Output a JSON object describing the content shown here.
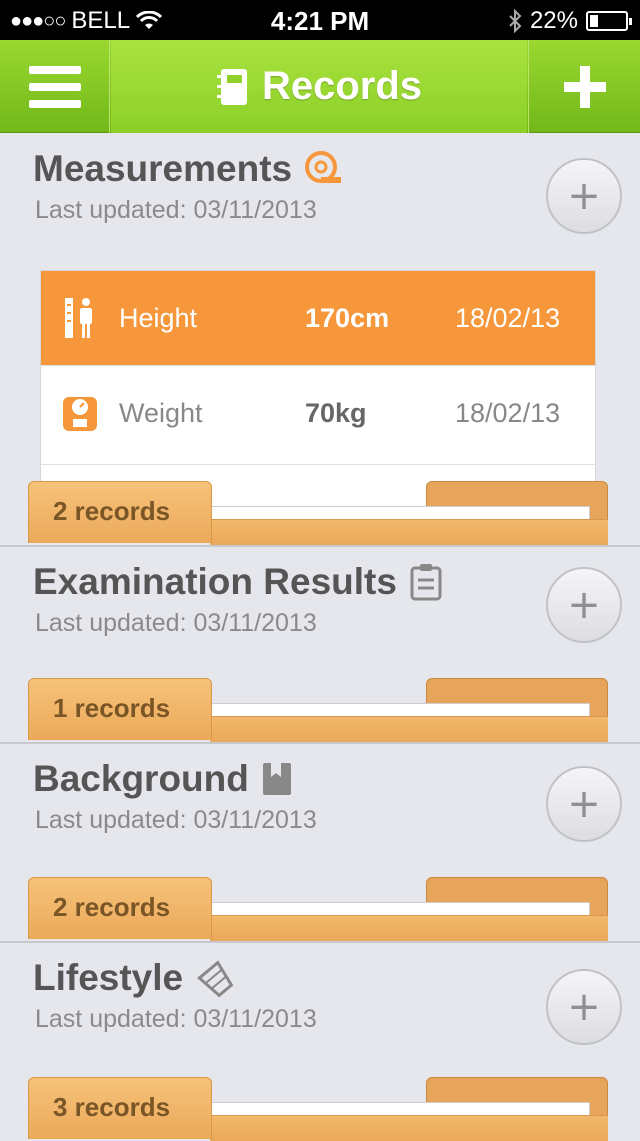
{
  "status": {
    "carrier": "BELL",
    "time": "4:21 PM",
    "battery": "22%"
  },
  "nav": {
    "title": "Records"
  },
  "sections": [
    {
      "title": "Measurements",
      "updated": "Last updated: 03/11/2013",
      "records": "2 records"
    },
    {
      "title": "Examination Results",
      "updated": "Last updated: 03/11/2013",
      "records": "1 records"
    },
    {
      "title": "Background",
      "updated": "Last updated: 03/11/2013",
      "records": "2 records"
    },
    {
      "title": "Lifestyle",
      "updated": "Last updated: 03/11/2013",
      "records": "3 records"
    }
  ],
  "measurements": [
    {
      "name": "Height",
      "value": "170cm",
      "date": "18/02/13"
    },
    {
      "name": "Weight",
      "value": "70kg",
      "date": "18/02/13"
    }
  ],
  "colors": {
    "nav_green": "#8ccf28",
    "accent_orange": "#f5973a",
    "folder": "#eba95a"
  }
}
